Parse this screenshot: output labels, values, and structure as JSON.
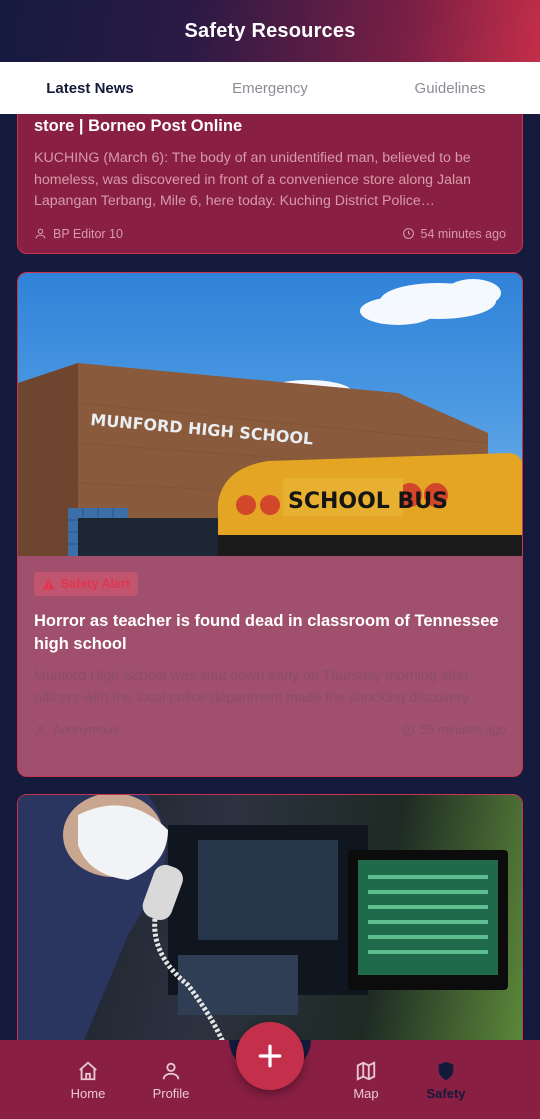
{
  "header": {
    "title": "Safety Resources"
  },
  "tabs": [
    {
      "label": "Latest News",
      "active": true
    },
    {
      "label": "Emergency",
      "active": false
    },
    {
      "label": "Guidelines",
      "active": false
    }
  ],
  "feed": {
    "cards": [
      {
        "title": "store | Borneo Post Online",
        "excerpt": "KUCHING (March 6): The body of an unidentified man, believed to be homeless, was discovered in front of a convenience store along Jalan Lapangan Terbang, Mile 6, here today. Kuching District Police…",
        "author": "BP Editor 10",
        "time": "54 minutes ago"
      },
      {
        "badge": "Safety Alert",
        "title": "Horror as teacher is found dead in classroom of Tennessee high school",
        "excerpt": "Munford High School was shut down early on Thursday morning after officers with the local police department made the shocking discovery",
        "author": "Anonymous",
        "time": "55 minutes ago",
        "photo_text": {
          "building_sign": "MUNFORD HIGH SCHOOL",
          "bus_sign": "SCHOOL BUS"
        }
      },
      {
        "photo": "dispatcher-monitors"
      }
    ]
  },
  "bottom_nav": {
    "items": [
      {
        "label": "Home",
        "icon": "home-icon"
      },
      {
        "label": "Profile",
        "icon": "user-icon"
      },
      {
        "label": "Map",
        "icon": "map-icon"
      },
      {
        "label": "Safety",
        "icon": "shield-icon",
        "active": true
      }
    ],
    "fab_icon": "plus-icon"
  },
  "colors": {
    "accent": "#c4304b",
    "card": "#8a1f44",
    "background": "#141b3c"
  }
}
